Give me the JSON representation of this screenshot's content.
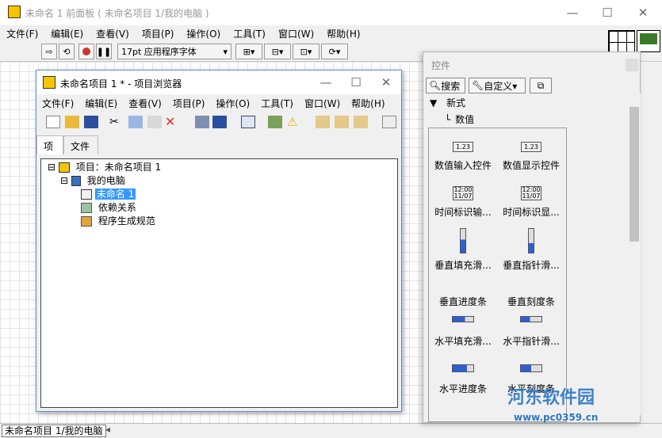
{
  "main_window": {
    "title": "未命名 1 前面板 ( 未命名项目 1/我的电脑 )",
    "menu": [
      "文件(F)",
      "编辑(E)",
      "查看(V)",
      "项目(P)",
      "操作(O)",
      "工具(T)",
      "窗口(W)",
      "帮助(H)"
    ],
    "font_select": "17pt 应用程序字体",
    "status_text": "未命名项目 1/我的电脑"
  },
  "project_browser": {
    "title": "未命名项目 1 * - 项目浏览器",
    "menu": [
      "文件(F)",
      "编辑(E)",
      "查看(V)",
      "项目(P)",
      "操作(O)",
      "工具(T)",
      "窗口(W)",
      "帮助(H)"
    ],
    "tabs": [
      "项",
      "文件"
    ],
    "tree": {
      "root": "项目：未命名项目 1",
      "computer": "我的电脑",
      "vi": "未命名 1",
      "deps": "依赖关系",
      "build": "程序生成规范"
    }
  },
  "palette": {
    "title": "控件",
    "search_label": "搜索",
    "customize_label": "自定义▾",
    "category": "新式",
    "subcategory": "数值",
    "controls": [
      "数值输入控件",
      "数值显示控件",
      "时间标识输...",
      "时间标识显...",
      "垂直填充滑...",
      "垂直指针滑...",
      "垂直进度条",
      "垂直刻度条",
      "水平填充滑...",
      "水平指针滑...",
      "水平进度条",
      "水平刻度条"
    ],
    "numeric_value": "1.23",
    "time_value_1": "12:00",
    "time_value_2": "11/07"
  },
  "watermark": {
    "text": "河东软件园",
    "url": "www.pc0359.cn"
  },
  "colors": {
    "selection": "#3399ff",
    "window_border": "#5d8fd0",
    "watermark": "#2c78c9"
  }
}
